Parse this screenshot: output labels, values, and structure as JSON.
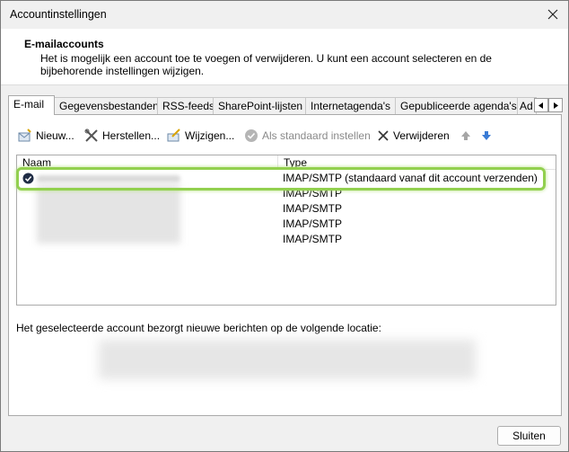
{
  "window": {
    "title": "Accountinstellingen"
  },
  "header": {
    "title": "E-mailaccounts",
    "description": "Het is mogelijk een account toe te voegen of verwijderen. U kunt een account selecteren en de bijbehorende instellingen wijzigen."
  },
  "tabs": [
    {
      "label": "E-mail",
      "active": true
    },
    {
      "label": "Gegevensbestanden"
    },
    {
      "label": "RSS-feeds"
    },
    {
      "label": "SharePoint-lijsten"
    },
    {
      "label": "Internetagenda's"
    },
    {
      "label": "Gepubliceerde agenda's"
    },
    {
      "label": "Ad"
    }
  ],
  "toolbar": {
    "new_label": "Nieuw...",
    "repair_label": "Herstellen...",
    "change_label": "Wijzigen...",
    "default_label": "Als standaard instellen",
    "remove_label": "Verwijderen"
  },
  "accounts": {
    "col_name": "Naam",
    "col_type": "Type",
    "rows": [
      {
        "type": "IMAP/SMTP (standaard vanaf dit account verzenden)",
        "default": true
      },
      {
        "type": "IMAP/SMTP"
      },
      {
        "type": "IMAP/SMTP"
      },
      {
        "type": "IMAP/SMTP"
      },
      {
        "type": "IMAP/SMTP"
      }
    ]
  },
  "location": {
    "label": "Het geselecteerde account bezorgt nieuwe berichten op de volgende locatie:"
  },
  "footer": {
    "close_label": "Sluiten"
  },
  "colors": {
    "highlight": "#92d04f",
    "arrow_up": "#a6a6a6",
    "arrow_down": "#3a7bd5"
  },
  "icons": [
    "close-icon",
    "new-account-icon",
    "repair-icon",
    "change-icon",
    "check-circle-icon",
    "remove-x-icon",
    "arrow-up-icon",
    "arrow-down-icon",
    "default-check-icon"
  ]
}
